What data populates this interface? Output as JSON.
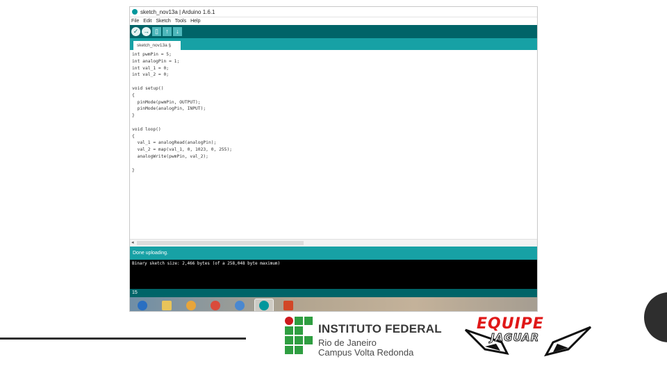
{
  "window": {
    "title": "sketch_nov13a | Arduino 1.6.1"
  },
  "menu": [
    "File",
    "Edit",
    "Sketch",
    "Tools",
    "Help"
  ],
  "toolbar": [
    {
      "name": "verify-button",
      "glyph": "✓"
    },
    {
      "name": "upload-button",
      "glyph": "→"
    },
    {
      "name": "new-button",
      "glyph": "▯"
    },
    {
      "name": "open-button",
      "glyph": "↑"
    },
    {
      "name": "save-button",
      "glyph": "↓"
    }
  ],
  "tab": {
    "label": "sketch_nov13a §"
  },
  "code": [
    "int pwmPin = 5;",
    "int analogPin = 1;",
    "int val_1 = 0;",
    "int val_2 = 0;",
    "",
    "void setup()",
    "{",
    "  pinMode(pwmPin, OUTPUT);",
    "  pinMode(analogPin, INPUT);",
    "}",
    "",
    "void loop()",
    "{",
    "  val_1 = analogRead(analogPin);",
    "  val_2 = map(val_1, 0, 1023, 0, 255);",
    "  analogWrite(pwmPin, val_2);",
    "",
    "}"
  ],
  "status": {
    "message": "Done uploading."
  },
  "console": {
    "line": "Binary sketch size: 2,466 bytes (of a 258,048 byte maximum)"
  },
  "footer": {
    "line_number": "15"
  },
  "taskbar": [
    {
      "name": "start-button",
      "color": "#2a6fc1"
    },
    {
      "name": "explorer-taskbar-icon",
      "color": "#e8c45a"
    },
    {
      "name": "media-player-taskbar-icon",
      "color": "#e8a53a"
    },
    {
      "name": "chrome-taskbar-icon",
      "color": "#d94b3b"
    },
    {
      "name": "itunes-taskbar-icon",
      "color": "#4a88d0"
    },
    {
      "name": "arduino-taskbar-icon",
      "color": "#00979c"
    },
    {
      "name": "powerpoint-taskbar-icon",
      "color": "#d24726"
    }
  ],
  "logos": {
    "ifrj": {
      "line1": "INSTITUTO FEDERAL",
      "line2": "Rio de Janeiro",
      "line3": "Campus Volta Redonda",
      "green": "#2f9e41",
      "red": "#cd191e"
    },
    "jaguar": {
      "line1": "EQUIPE",
      "line2": "JAGUAR",
      "color": "#e01818"
    }
  }
}
